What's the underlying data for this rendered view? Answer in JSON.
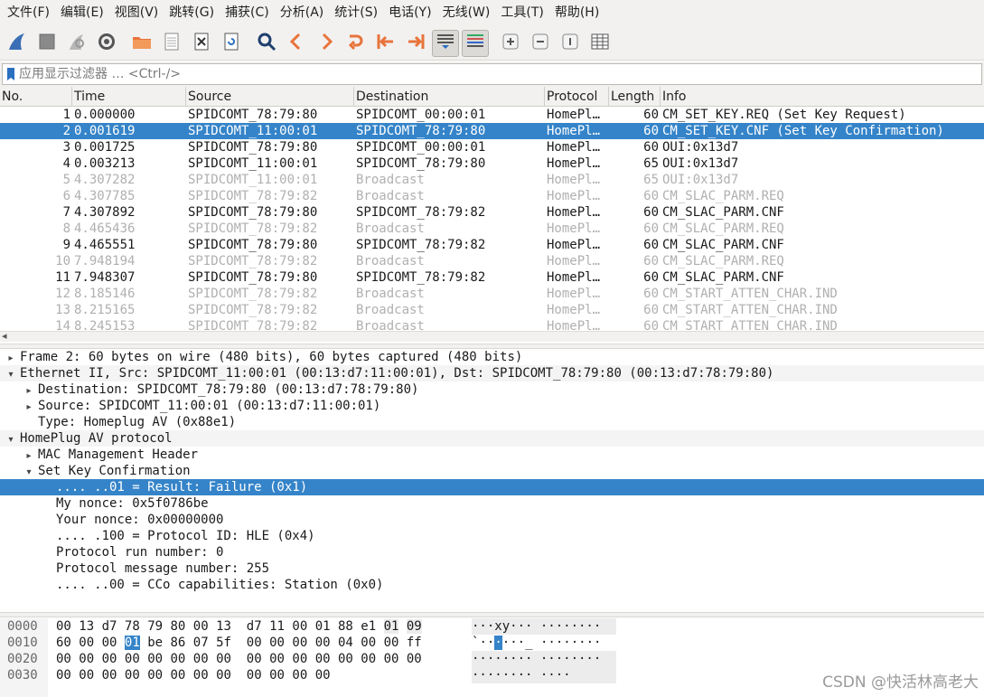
{
  "menu": [
    "文件(F)",
    "编辑(E)",
    "视图(V)",
    "跳转(G)",
    "捕获(C)",
    "分析(A)",
    "统计(S)",
    "电话(Y)",
    "无线(W)",
    "工具(T)",
    "帮助(H)"
  ],
  "filter": {
    "placeholder": "应用显示过滤器 … <Ctrl-/>"
  },
  "packet_list": {
    "columns": [
      "No.",
      "Time",
      "Source",
      "Destination",
      "Protocol",
      "Length",
      "Info"
    ],
    "rows": [
      {
        "no": "1",
        "time": "0.000000",
        "src": "SPIDCOMT_78:79:80",
        "dst": "SPIDCOMT_00:00:01",
        "proto": "HomePl…",
        "len": "60",
        "info": "CM_SET_KEY.REQ (Set Key Request)",
        "state": "normal"
      },
      {
        "no": "2",
        "time": "0.001619",
        "src": "SPIDCOMT_11:00:01",
        "dst": "SPIDCOMT_78:79:80",
        "proto": "HomePl…",
        "len": "60",
        "info": "CM_SET_KEY.CNF (Set Key Confirmation)",
        "state": "selected"
      },
      {
        "no": "3",
        "time": "0.001725",
        "src": "SPIDCOMT_78:79:80",
        "dst": "SPIDCOMT_00:00:01",
        "proto": "HomePl…",
        "len": "60",
        "info": "OUI:0x13d7",
        "state": "normal"
      },
      {
        "no": "4",
        "time": "0.003213",
        "src": "SPIDCOMT_11:00:01",
        "dst": "SPIDCOMT_78:79:80",
        "proto": "HomePl…",
        "len": "65",
        "info": "OUI:0x13d7",
        "state": "normal"
      },
      {
        "no": "5",
        "time": "4.307282",
        "src": "SPIDCOMT_11:00:01",
        "dst": "Broadcast",
        "proto": "HomePl…",
        "len": "65",
        "info": "OUI:0x13d7",
        "state": "dim"
      },
      {
        "no": "6",
        "time": "4.307785",
        "src": "SPIDCOMT_78:79:82",
        "dst": "Broadcast",
        "proto": "HomePl…",
        "len": "60",
        "info": "CM_SLAC_PARM.REQ",
        "state": "dim"
      },
      {
        "no": "7",
        "time": "4.307892",
        "src": "SPIDCOMT_78:79:80",
        "dst": "SPIDCOMT_78:79:82",
        "proto": "HomePl…",
        "len": "60",
        "info": "CM_SLAC_PARM.CNF",
        "state": "normal"
      },
      {
        "no": "8",
        "time": "4.465436",
        "src": "SPIDCOMT_78:79:82",
        "dst": "Broadcast",
        "proto": "HomePl…",
        "len": "60",
        "info": "CM_SLAC_PARM.REQ",
        "state": "dim"
      },
      {
        "no": "9",
        "time": "4.465551",
        "src": "SPIDCOMT_78:79:80",
        "dst": "SPIDCOMT_78:79:82",
        "proto": "HomePl…",
        "len": "60",
        "info": "CM_SLAC_PARM.CNF",
        "state": "normal"
      },
      {
        "no": "10",
        "time": "7.948194",
        "src": "SPIDCOMT_78:79:82",
        "dst": "Broadcast",
        "proto": "HomePl…",
        "len": "60",
        "info": "CM_SLAC_PARM.REQ",
        "state": "dim"
      },
      {
        "no": "11",
        "time": "7.948307",
        "src": "SPIDCOMT_78:79:80",
        "dst": "SPIDCOMT_78:79:82",
        "proto": "HomePl…",
        "len": "60",
        "info": "CM_SLAC_PARM.CNF",
        "state": "normal"
      },
      {
        "no": "12",
        "time": "8.185146",
        "src": "SPIDCOMT_78:79:82",
        "dst": "Broadcast",
        "proto": "HomePl…",
        "len": "60",
        "info": "CM_START_ATTEN_CHAR.IND",
        "state": "dim"
      },
      {
        "no": "13",
        "time": "8.215165",
        "src": "SPIDCOMT_78:79:82",
        "dst": "Broadcast",
        "proto": "HomePl…",
        "len": "60",
        "info": "CM_START_ATTEN_CHAR.IND",
        "state": "dim"
      },
      {
        "no": "14",
        "time": "8.245153",
        "src": "SPIDCOMT_78:79:82",
        "dst": "Broadcast",
        "proto": "HomePl…",
        "len": "60",
        "info": "CM_START_ATTEN_CHAR.IND",
        "state": "dim"
      }
    ]
  },
  "details": [
    {
      "level": 0,
      "twisty": "collapsed",
      "text": "Frame 2: 60 bytes on wire (480 bits), 60 bytes captured (480 bits)",
      "state": "normal"
    },
    {
      "level": 0,
      "twisty": "expanded",
      "text": "Ethernet II, Src: SPIDCOMT_11:00:01 (00:13:d7:11:00:01), Dst: SPIDCOMT_78:79:80 (00:13:d7:78:79:80)",
      "state": "hl"
    },
    {
      "level": 1,
      "twisty": "collapsed",
      "text": "Destination: SPIDCOMT_78:79:80 (00:13:d7:78:79:80)",
      "state": "normal"
    },
    {
      "level": 1,
      "twisty": "collapsed",
      "text": "Source: SPIDCOMT_11:00:01 (00:13:d7:11:00:01)",
      "state": "normal"
    },
    {
      "level": 1,
      "twisty": "none",
      "text": "Type: Homeplug AV (0x88e1)",
      "state": "normal"
    },
    {
      "level": 0,
      "twisty": "expanded",
      "text": "HomePlug AV protocol",
      "state": "hl"
    },
    {
      "level": 1,
      "twisty": "collapsed",
      "text": "MAC Management Header",
      "state": "normal"
    },
    {
      "level": 1,
      "twisty": "expanded",
      "text": "Set Key Confirmation",
      "state": "normal"
    },
    {
      "level": 2,
      "twisty": "none",
      "text": ".... ..01 = Result: Failure (0x1)",
      "state": "selected"
    },
    {
      "level": 2,
      "twisty": "none",
      "text": "My nonce: 0x5f0786be",
      "state": "normal"
    },
    {
      "level": 2,
      "twisty": "none",
      "text": "Your nonce: 0x00000000",
      "state": "normal"
    },
    {
      "level": 2,
      "twisty": "none",
      "text": ".... .100 = Protocol ID: HLE (0x4)",
      "state": "normal"
    },
    {
      "level": 2,
      "twisty": "none",
      "text": "Protocol run number: 0",
      "state": "normal"
    },
    {
      "level": 2,
      "twisty": "none",
      "text": "Protocol message number: 255",
      "state": "normal"
    },
    {
      "level": 2,
      "twisty": "none",
      "text": ".... ..00 = CCo capabilities: Station (0x0)",
      "state": "normal"
    }
  ],
  "bytes": [
    {
      "offset": "0000",
      "hex": [
        "00",
        "13",
        "d7",
        "78",
        "79",
        "80",
        "00",
        "13",
        "d7",
        "11",
        "00",
        "01",
        "88",
        "e1",
        "01",
        "09"
      ],
      "ascii": "···xy··· ········"
    },
    {
      "offset": "0010",
      "hex": [
        "60",
        "00",
        "00",
        "01",
        "be",
        "86",
        "07",
        "5f",
        "00",
        "00",
        "00",
        "00",
        "04",
        "00",
        "00",
        "ff"
      ],
      "ascii": "`······_ ········"
    },
    {
      "offset": "0020",
      "hex": [
        "00",
        "00",
        "00",
        "00",
        "00",
        "00",
        "00",
        "00",
        "00",
        "00",
        "00",
        "00",
        "00",
        "00",
        "00",
        "00"
      ],
      "ascii": "········ ········"
    },
    {
      "offset": "0030",
      "hex": [
        "00",
        "00",
        "00",
        "00",
        "00",
        "00",
        "00",
        "00",
        "00",
        "00",
        "00",
        "00"
      ],
      "ascii": "········ ····"
    }
  ],
  "watermark": "CSDN @快活林高老大",
  "colors": {
    "selection": "#3584c9",
    "dim_text": "#b0b0b0",
    "chrome": "#f2f1f0"
  }
}
